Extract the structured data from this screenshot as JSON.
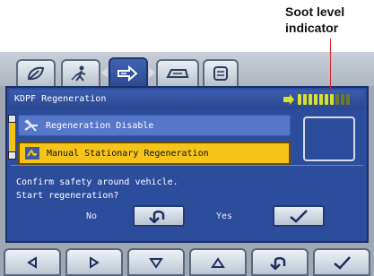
{
  "annotation": {
    "line1": "Soot level",
    "line2": "indicator"
  },
  "tabs": [
    {
      "icon": "leaf-icon"
    },
    {
      "icon": "operator-icon"
    },
    {
      "icon": "regeneration-icon",
      "active": true
    },
    {
      "icon": "machine-icon"
    },
    {
      "icon": "list-icon"
    }
  ],
  "screen": {
    "title": "KDPF Regeneration",
    "soot_level": {
      "filled": 7,
      "total": 10
    },
    "menu": [
      {
        "label": "Regeneration Disable",
        "icon": "regeneration-disable-icon",
        "selected": false
      },
      {
        "label": "Manual Stationary Regeneration",
        "icon": "manual-regeneration-icon",
        "selected": true
      }
    ],
    "message": {
      "line1": "Confirm safety around vehicle.",
      "line2": "Start regeneration?"
    },
    "dialog": {
      "no_label": "No",
      "yes_label": "Yes"
    }
  },
  "softkeys": [
    "left-arrow-icon",
    "right-arrow-icon",
    "down-arrow-icon",
    "up-arrow-icon",
    "back-icon",
    "check-icon"
  ],
  "colors": {
    "screen_bg": "#2c4c9c",
    "selected_item": "#f5c419",
    "soot_filled": "#d9e02a",
    "soot_empty": "#6c7a2a",
    "callout_line": "#d8262c"
  }
}
